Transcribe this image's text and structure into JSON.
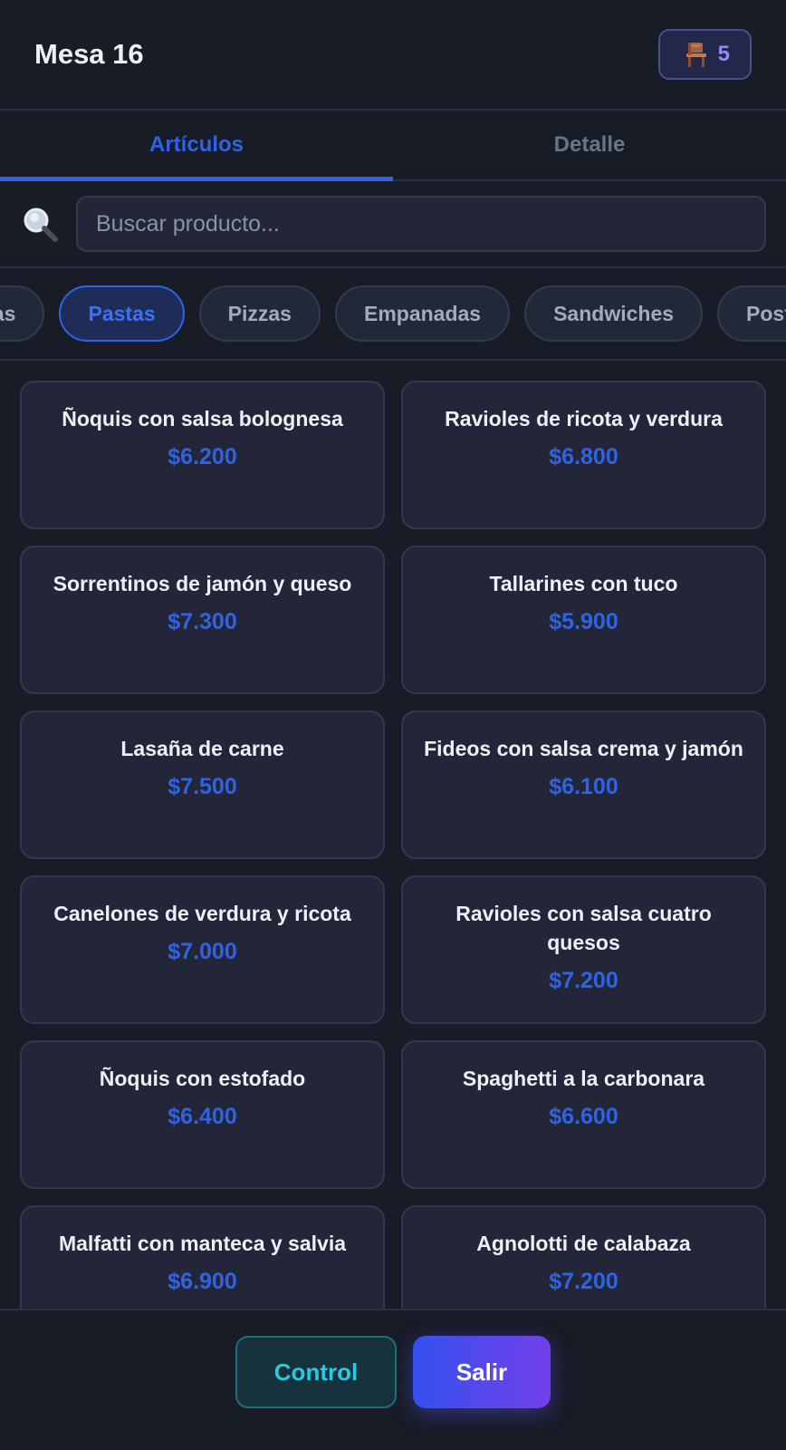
{
  "header": {
    "title": "Mesa 16",
    "seat_count": "5"
  },
  "tabs": [
    {
      "label": "Artículos",
      "active": true
    },
    {
      "label": "Detalle",
      "active": false
    }
  ],
  "search": {
    "placeholder": "Buscar producto...",
    "value": ""
  },
  "categories": [
    {
      "label": "Bebidas",
      "active": false
    },
    {
      "label": "Pastas",
      "active": true
    },
    {
      "label": "Pizzas",
      "active": false
    },
    {
      "label": "Empanadas",
      "active": false
    },
    {
      "label": "Sandwiches",
      "active": false
    },
    {
      "label": "Postres",
      "active": false
    }
  ],
  "products": [
    {
      "name": "Ñoquis con salsa bolognesa",
      "price": "$6.200"
    },
    {
      "name": "Ravioles de ricota y verdura",
      "price": "$6.800"
    },
    {
      "name": "Sorrentinos de jamón y queso",
      "price": "$7.300"
    },
    {
      "name": "Tallarines con tuco",
      "price": "$5.900"
    },
    {
      "name": "Lasaña de carne",
      "price": "$7.500"
    },
    {
      "name": "Fideos con salsa crema y jamón",
      "price": "$6.100"
    },
    {
      "name": "Canelones de verdura y ricota",
      "price": "$7.000"
    },
    {
      "name": "Ravioles con salsa cuatro quesos",
      "price": "$7.200"
    },
    {
      "name": "Ñoquis con estofado",
      "price": "$6.400"
    },
    {
      "name": "Spaghetti a la carbonara",
      "price": "$6.600"
    },
    {
      "name": "Malfatti con manteca y salvia",
      "price": "$6.900"
    },
    {
      "name": "Agnolotti de calabaza",
      "price": "$7.200"
    }
  ],
  "footer": {
    "control_label": "Control",
    "exit_label": "Salir"
  },
  "colors": {
    "accent": "#2f63e3",
    "background": "#181c26",
    "card": "#222638",
    "control_text": "#2cc9de",
    "exit_gradient_start": "#3550ef",
    "exit_gradient_end": "#7340ea",
    "seat_badge_text": "#8b8ff0"
  },
  "icons": {
    "seat": "chair-icon",
    "search": "search-icon"
  }
}
